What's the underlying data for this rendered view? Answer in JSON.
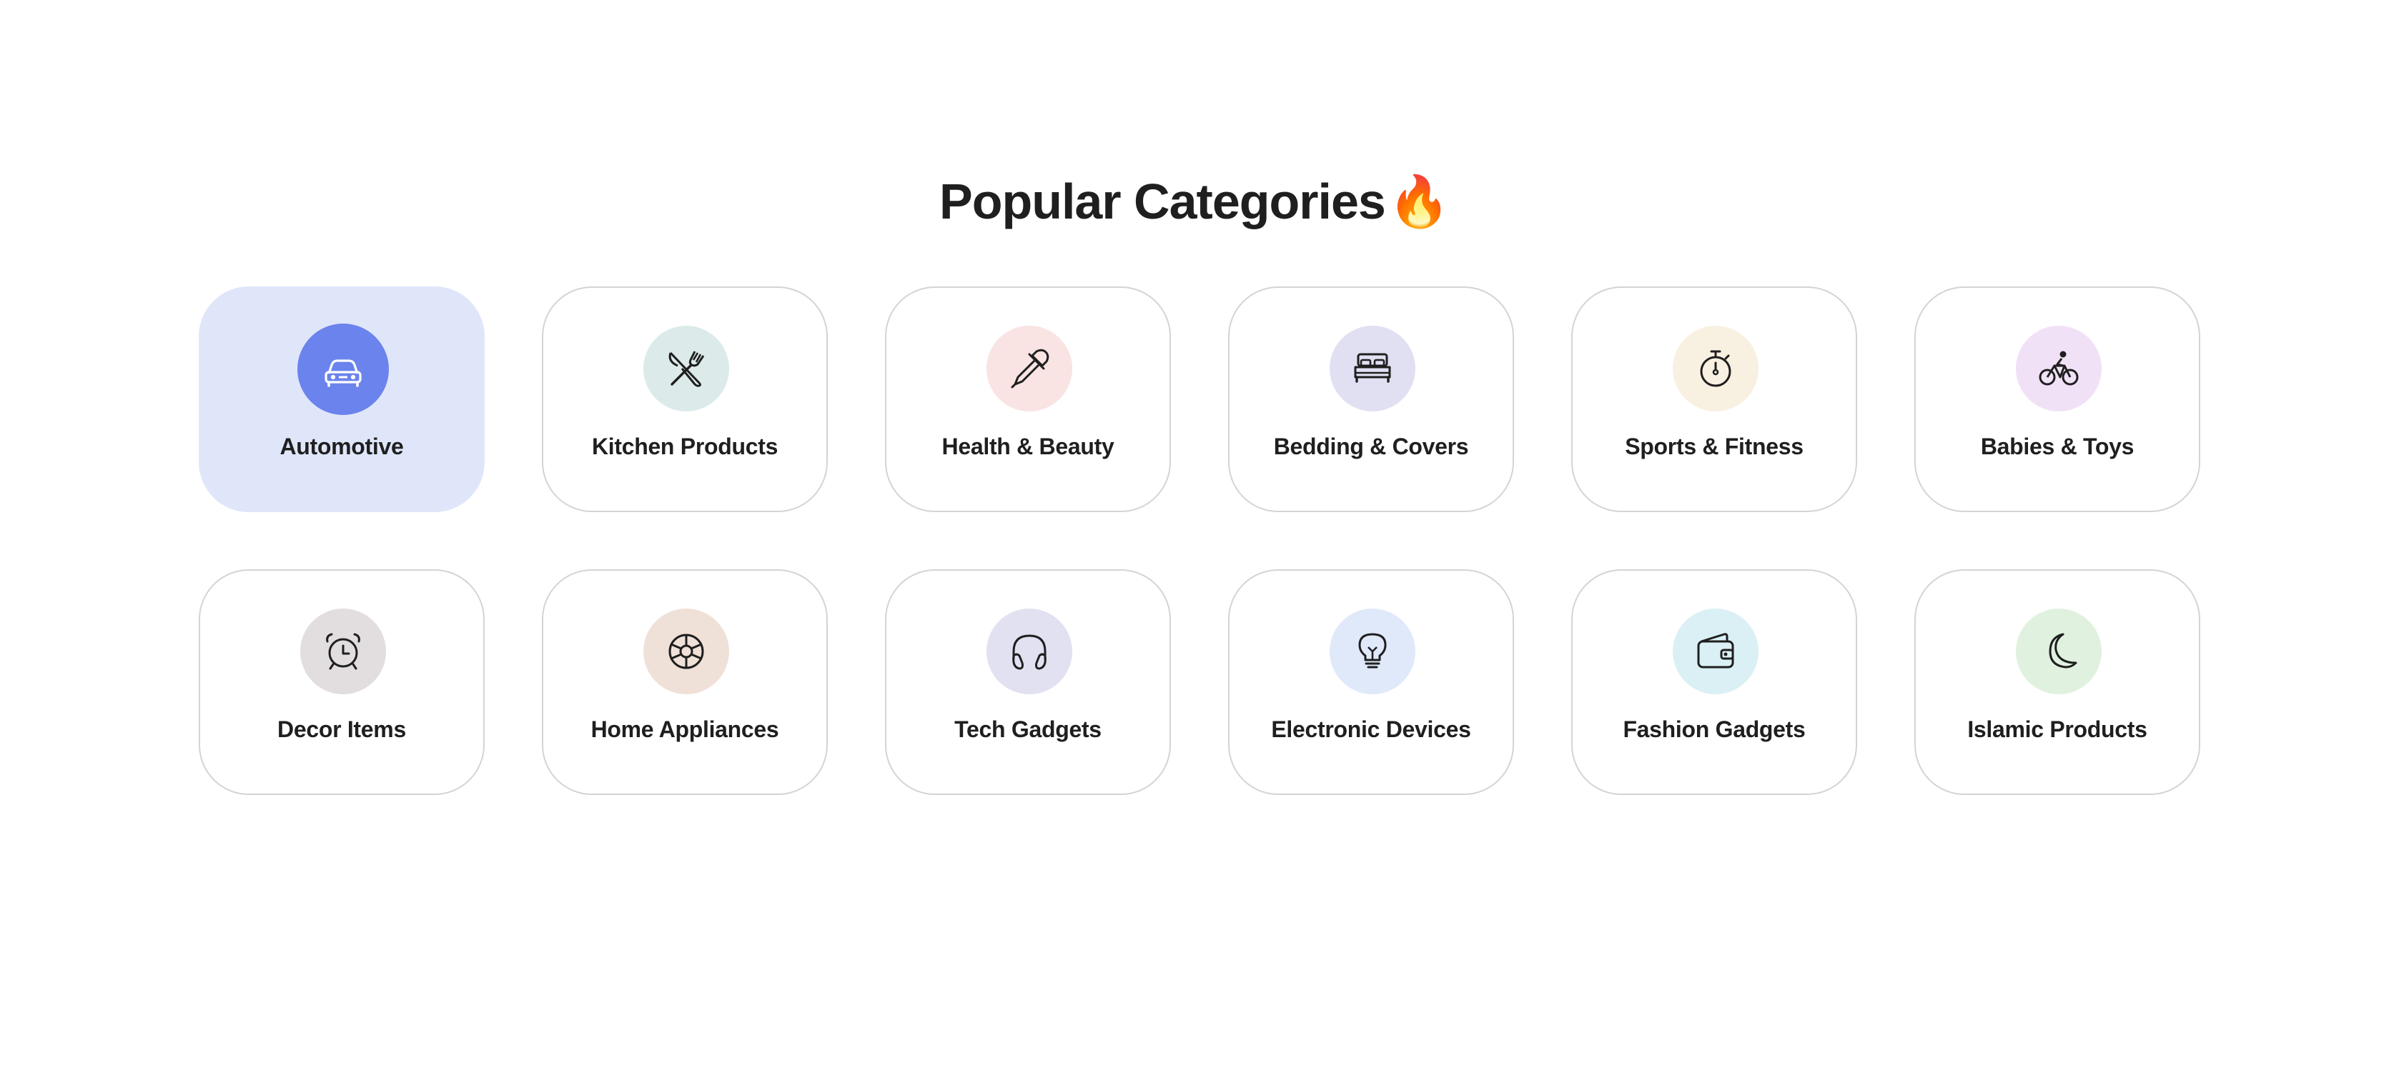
{
  "section": {
    "title": "Popular Categories",
    "title_emoji": "🔥"
  },
  "categories": [
    {
      "label": "Automotive",
      "icon": "car-icon",
      "circle_color": "#6b83ec",
      "card_color": "#e0e6fa",
      "icon_color": "#ffffff",
      "active": true
    },
    {
      "label": "Kitchen Products",
      "icon": "utensils-icon",
      "circle_color": "#dcebea",
      "card_color": "#ffffff",
      "icon_color": "#1f1f1f",
      "active": false
    },
    {
      "label": "Health & Beauty",
      "icon": "dropper-icon",
      "circle_color": "#f9e3e3",
      "card_color": "#ffffff",
      "icon_color": "#1f1f1f",
      "active": false
    },
    {
      "label": "Bedding & Covers",
      "icon": "bed-icon",
      "circle_color": "#e1e0f3",
      "card_color": "#ffffff",
      "icon_color": "#1f1f1f",
      "active": false
    },
    {
      "label": "Sports & Fitness",
      "icon": "stopwatch-icon",
      "circle_color": "#f8f1e1",
      "card_color": "#ffffff",
      "icon_color": "#1f1f1f",
      "active": false
    },
    {
      "label": "Babies & Toys",
      "icon": "bicycle-icon",
      "circle_color": "#f1e1f6",
      "card_color": "#ffffff",
      "icon_color": "#1f1f1f",
      "active": false
    },
    {
      "label": "Decor Items",
      "icon": "alarm-clock-icon",
      "circle_color": "#e2dddf",
      "card_color": "#ffffff",
      "icon_color": "#1f1f1f",
      "active": false
    },
    {
      "label": "Home Appliances",
      "icon": "fan-wheel-icon",
      "circle_color": "#f0e1d8",
      "card_color": "#ffffff",
      "icon_color": "#1f1f1f",
      "active": false
    },
    {
      "label": "Tech Gadgets",
      "icon": "headphones-icon",
      "circle_color": "#e2e1f1",
      "card_color": "#ffffff",
      "icon_color": "#1f1f1f",
      "active": false
    },
    {
      "label": "Electronic Devices",
      "icon": "lightbulb-icon",
      "circle_color": "#e0e9fa",
      "card_color": "#ffffff",
      "icon_color": "#1f1f1f",
      "active": false
    },
    {
      "label": "Fashion Gadgets",
      "icon": "wallet-icon",
      "circle_color": "#daf0f4",
      "card_color": "#ffffff",
      "icon_color": "#1f1f1f",
      "active": false
    },
    {
      "label": "Islamic Products",
      "icon": "moon-icon",
      "circle_color": "#e0f2df",
      "card_color": "#ffffff",
      "icon_color": "#1f1f1f",
      "active": false
    }
  ]
}
